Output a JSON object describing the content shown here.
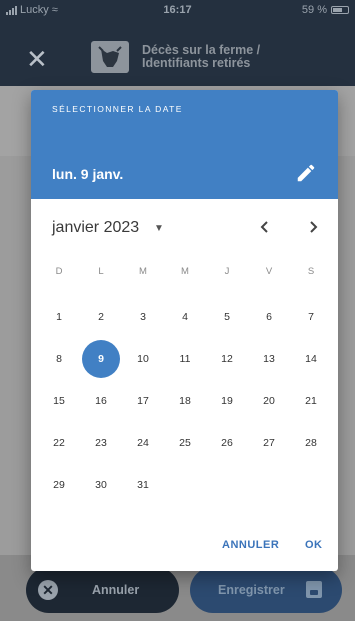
{
  "status_bar": {
    "carrier": "Lucky",
    "time": "16:17",
    "battery": "59 %"
  },
  "app_header": {
    "title_line1": "Décès sur la ferme /",
    "title_line2": "Identifiants retirés"
  },
  "dialog": {
    "overline": "SÉLECTIONNER LA DATE",
    "selected_date": "lun. 9 janv.",
    "month_label": "janvier 2023",
    "weekdays": [
      "D",
      "L",
      "M",
      "M",
      "J",
      "V",
      "S"
    ],
    "weeks": [
      [
        "1",
        "2",
        "3",
        "4",
        "5",
        "6",
        "7"
      ],
      [
        "8",
        "9",
        "10",
        "11",
        "12",
        "13",
        "14"
      ],
      [
        "15",
        "16",
        "17",
        "18",
        "19",
        "20",
        "21"
      ],
      [
        "22",
        "23",
        "24",
        "25",
        "26",
        "27",
        "28"
      ],
      [
        "29",
        "30",
        "31"
      ]
    ],
    "selected_day": "9",
    "cancel_label": "ANNULER",
    "ok_label": "OK"
  },
  "bottom": {
    "cancel_label": "Annuler",
    "save_label": "Enregistrer"
  },
  "colors": {
    "accent": "#4180c4",
    "header_bg": "#24303f"
  }
}
